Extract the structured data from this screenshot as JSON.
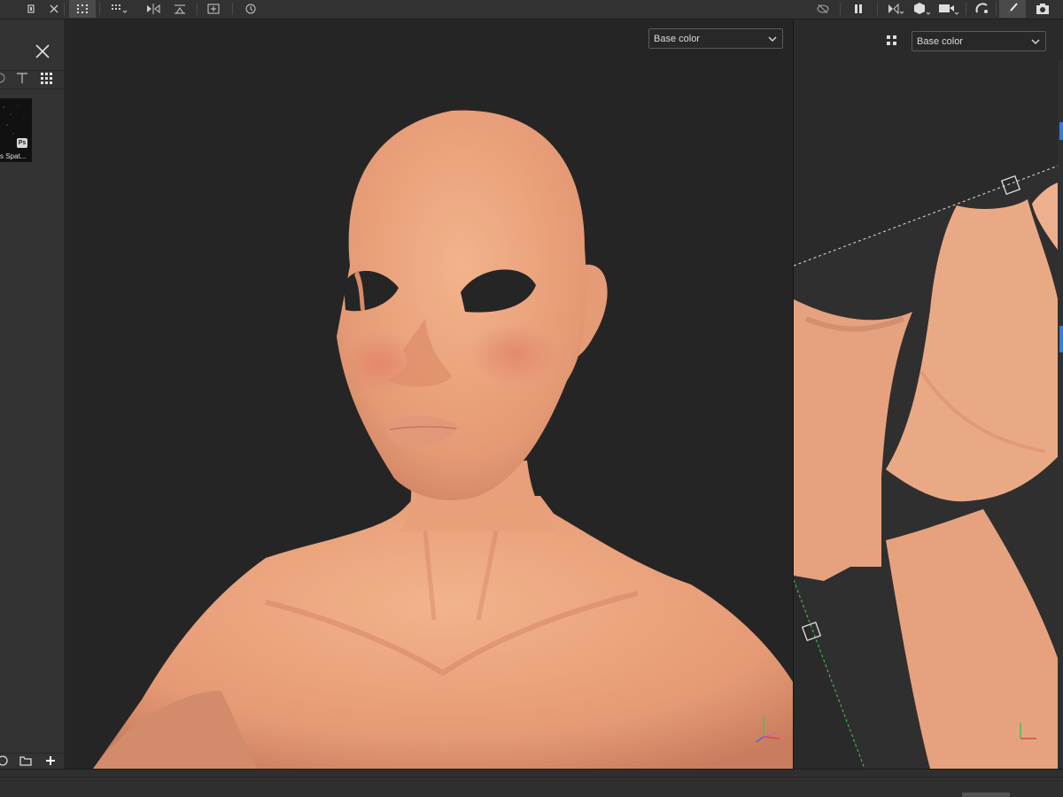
{
  "viewport3d": {
    "channel_select": "Base color"
  },
  "viewport2d": {
    "channel_select": "Base color"
  },
  "shelf": {
    "thumbnail_label": "s Spat...",
    "thumbnail_badge": "Ps"
  },
  "toolbar": {
    "left_icons": [
      "window-restore-icon",
      "close-icon",
      "selection-grid-icon",
      "grid-options-icon",
      "symmetry-icon",
      "align-icon",
      "add-layer-icon",
      "history-icon"
    ],
    "right_icons": [
      "hide-icon",
      "pause-icon",
      "split-view-icon",
      "cube-icon",
      "camera-video-icon",
      "lights-icon",
      "brush-icon",
      "screenshot-icon"
    ]
  },
  "colors": {
    "skin": "#e8a27c",
    "panel_bg": "#333333",
    "viewport_bg": "#252525"
  }
}
